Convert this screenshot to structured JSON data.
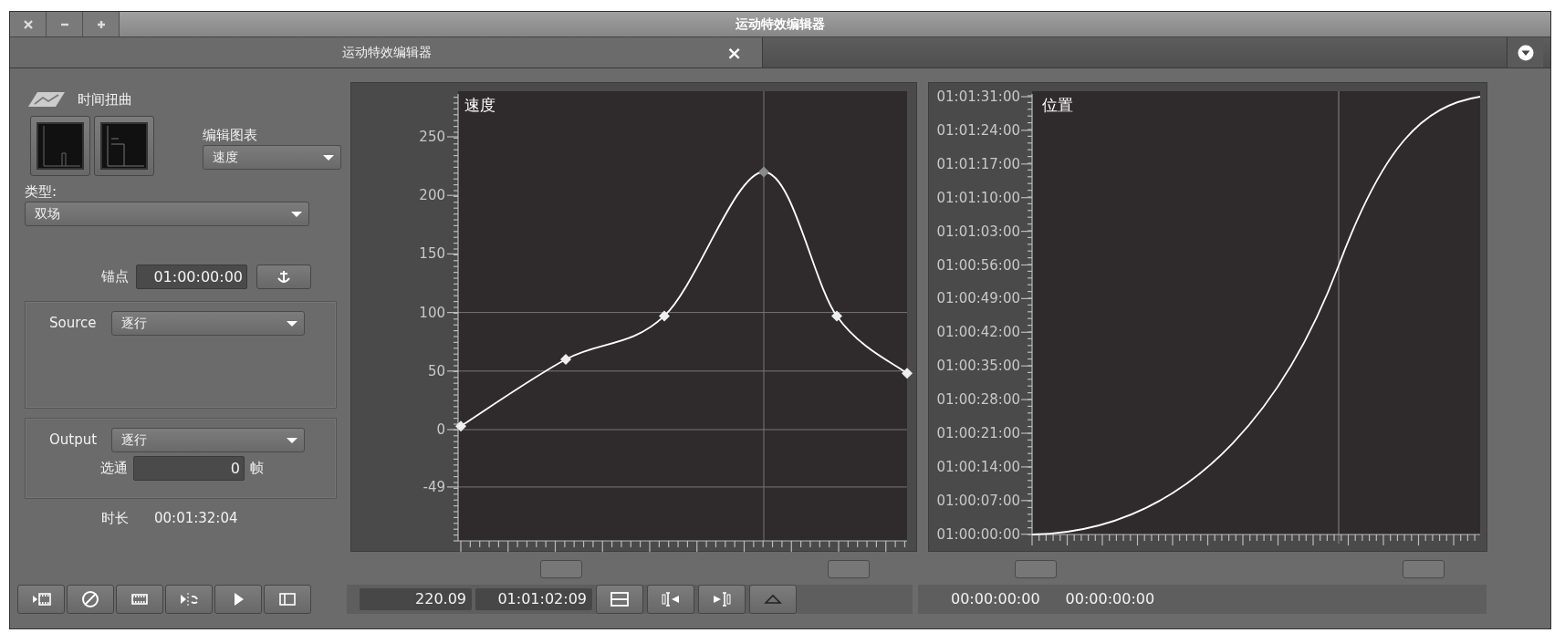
{
  "window": {
    "title": "运动特效编辑器"
  },
  "tab": {
    "label": "运动特效编辑器",
    "close": "×"
  },
  "effect": {
    "name": "时间扭曲"
  },
  "edit_graph": {
    "label": "编辑图表",
    "value": "速度"
  },
  "type": {
    "label": "类型:",
    "value": "双场"
  },
  "anchor": {
    "label": "锚点",
    "value": "01:00:00:00"
  },
  "source": {
    "label": "Source",
    "value": "逐行"
  },
  "output": {
    "label": "Output",
    "value": "逐行",
    "strobe_label": "选通",
    "strobe_value": "0",
    "strobe_unit": "帧"
  },
  "duration": {
    "label": "时长",
    "value": "00:01:32:04"
  },
  "speed_graph": {
    "title": "速度",
    "y_labels": [
      "250",
      "200",
      "150",
      "100",
      "50",
      "0",
      "-49"
    ]
  },
  "position_graph": {
    "title": "位置",
    "y_labels": [
      "01:01:31:00",
      "01:01:24:00",
      "01:01:17:00",
      "01:01:10:00",
      "01:01:03:00",
      "01:00:56:00",
      "01:00:49:00",
      "01:00:42:00",
      "01:00:35:00",
      "01:00:28:00",
      "01:00:21:00",
      "01:00:14:00",
      "01:00:07:00",
      "01:00:00:00"
    ]
  },
  "readouts": {
    "speed": "220.09",
    "timecode": "01:01:02:09"
  },
  "position_readouts": [
    "00:00:00:00",
    "00:00:00:00"
  ]
}
